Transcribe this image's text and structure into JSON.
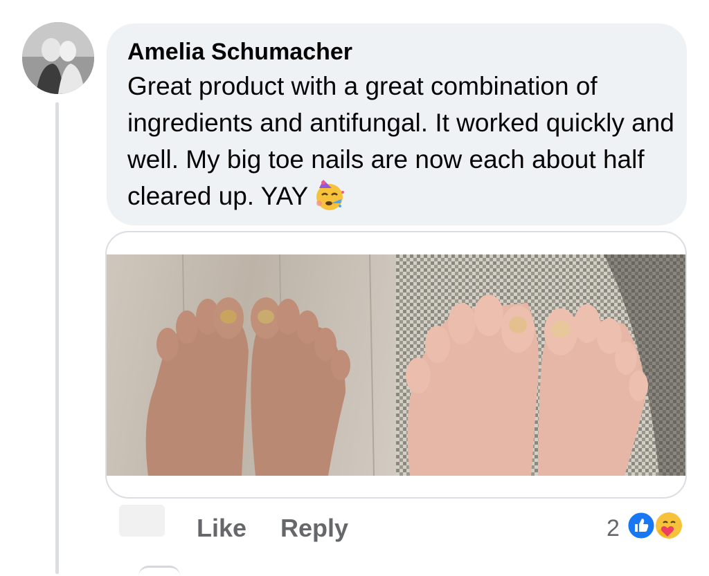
{
  "comment": {
    "author": "Amelia Schumacher",
    "text": "Great product with a great combination of ingredients and antifungal. It worked quickly and well. My big toe nails are now each about half cleared up. YAY",
    "inline_emoji": "partying-face-icon"
  },
  "actions": {
    "like_label": "Like",
    "reply_label": "Reply",
    "reaction_count": "2",
    "reactions": [
      "like-icon",
      "care-icon"
    ]
  },
  "colors": {
    "bubble": "#eff2f5",
    "action_text": "#65676b",
    "like_blue": "#1877f2"
  }
}
